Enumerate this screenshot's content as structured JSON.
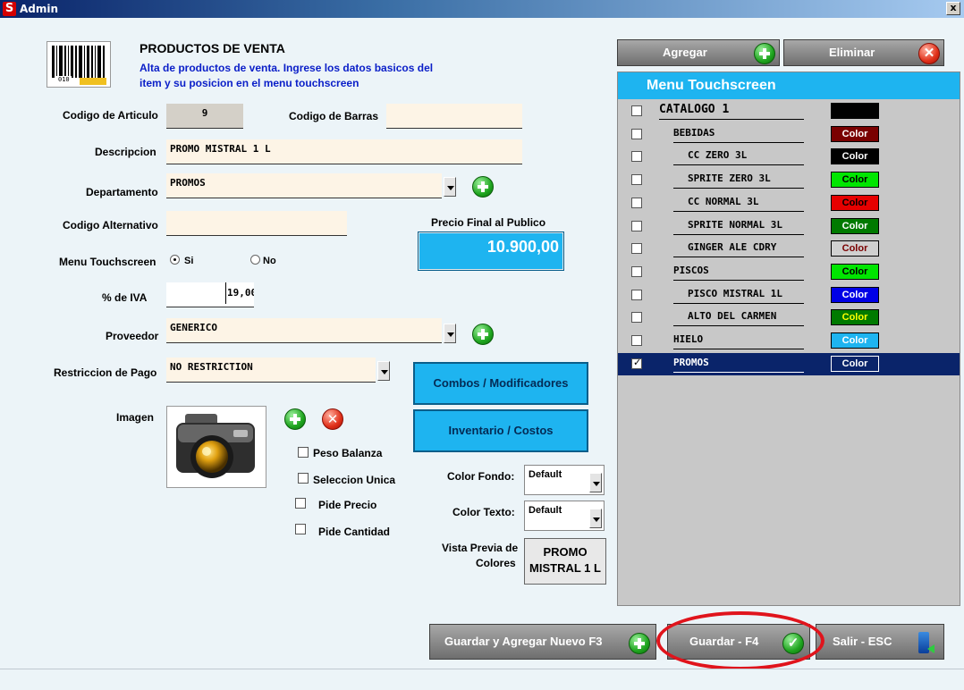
{
  "window": {
    "title": "Admin",
    "logo": "S",
    "close": "x"
  },
  "header": {
    "title": "PRODUCTOS DE VENTA",
    "subtitle_line1": "Alta de productos de venta. Ingrese los datos basicos del",
    "subtitle_line2": "item y su posicion en el menu touchscreen",
    "barcode_caption": "010"
  },
  "form": {
    "codigo_articulo_label": "Codigo de Articulo",
    "codigo_articulo_value": "9",
    "codigo_barras_label": "Codigo de Barras",
    "codigo_barras_value": "",
    "descripcion_label": "Descripcion",
    "descripcion_value": "PROMO MISTRAL 1 L",
    "departamento_label": "Departamento",
    "departamento_value": "PROMOS",
    "codigo_alternativo_label": "Codigo Alternativo",
    "codigo_alternativo_value": "",
    "precio_label": "Precio Final al Publico",
    "precio_value": "10.900,00",
    "menu_touch_label": "Menu Touchscreen",
    "radio_si": "Si",
    "radio_no": "No",
    "iva_label": "% de IVA",
    "iva_value": "19,00",
    "proveedor_label": "Proveedor",
    "proveedor_value": "GENERICO",
    "restriccion_label": "Restriccion de Pago",
    "restriccion_value": "NO RESTRICTION",
    "imagen_label": "Imagen",
    "peso_balanza": "Peso Balanza",
    "seleccion_unica": "Seleccion Unica",
    "pide_precio": "Pide Precio",
    "pide_cantidad": "Pide Cantidad",
    "color_fondo_label": "Color Fondo:",
    "color_fondo_value": "Default",
    "color_texto_label": "Color Texto:",
    "color_texto_value": "Default",
    "vista_previa_line1": "Vista Previa de",
    "vista_previa_line2": "Colores",
    "preview_line1": "PROMO",
    "preview_line2": "MISTRAL 1 L"
  },
  "buttons": {
    "combos": "Combos /  Modificadores",
    "inventario": "Inventario / Costos",
    "agregar": "Agregar",
    "eliminar": "Eliminar",
    "guardar_nuevo": "Guardar y Agregar Nuevo F3",
    "guardar": "Guardar - F4",
    "salir": "Salir - ESC"
  },
  "menu_touchscreen": {
    "title": "Menu Touchscreen",
    "items": [
      {
        "label": "CATALOGO 1",
        "color_label": "",
        "swatch": "#000000",
        "text": "#FFFFFF",
        "level": 0,
        "checked": false,
        "selected": false
      },
      {
        "label": "BEBIDAS",
        "color_label": "Color",
        "swatch": "#7A0000",
        "text": "#FFFFFF",
        "level": 1,
        "checked": false,
        "selected": false
      },
      {
        "label": "CC ZERO 3L",
        "color_label": "Color",
        "swatch": "#000000",
        "text": "#FFFFFF",
        "level": 2,
        "checked": false,
        "selected": false
      },
      {
        "label": "SPRITE ZERO 3L",
        "color_label": "Color",
        "swatch": "#00E600",
        "text": "#000000",
        "level": 2,
        "checked": false,
        "selected": false
      },
      {
        "label": "CC NORMAL 3L",
        "color_label": "Color",
        "swatch": "#E60000",
        "text": "#000000",
        "level": 2,
        "checked": false,
        "selected": false
      },
      {
        "label": "SPRITE NORMAL 3L",
        "color_label": "Color",
        "swatch": "#007A00",
        "text": "#FFFFFF",
        "level": 2,
        "checked": false,
        "selected": false
      },
      {
        "label": "GINGER ALE CDRY",
        "color_label": "Color",
        "swatch": "#D0D0D0",
        "text": "#7A0000",
        "level": 2,
        "checked": false,
        "selected": false
      },
      {
        "label": "PISCOS",
        "color_label": "Color",
        "swatch": "#00E600",
        "text": "#000000",
        "level": 1,
        "checked": false,
        "selected": false
      },
      {
        "label": "PISCO MISTRAL 1L",
        "color_label": "Color",
        "swatch": "#0000E6",
        "text": "#FFFFFF",
        "level": 2,
        "checked": false,
        "selected": false
      },
      {
        "label": "ALTO DEL CARMEN",
        "color_label": "Color",
        "swatch": "#007A00",
        "text": "#FFFF00",
        "level": 2,
        "checked": false,
        "selected": false
      },
      {
        "label": "HIELO",
        "color_label": "Color",
        "swatch": "#1EB4F0",
        "text": "#FFFFFF",
        "level": 1,
        "checked": false,
        "selected": false
      },
      {
        "label": "PROMOS",
        "color_label": "Color",
        "swatch": "#0A246A",
        "text": "#FFFFFF",
        "level": 1,
        "checked": true,
        "selected": true
      }
    ]
  },
  "colors": {
    "accent": "#1EB4F0",
    "selected": "#0A246A",
    "highlight_ring": "#E0141C"
  }
}
